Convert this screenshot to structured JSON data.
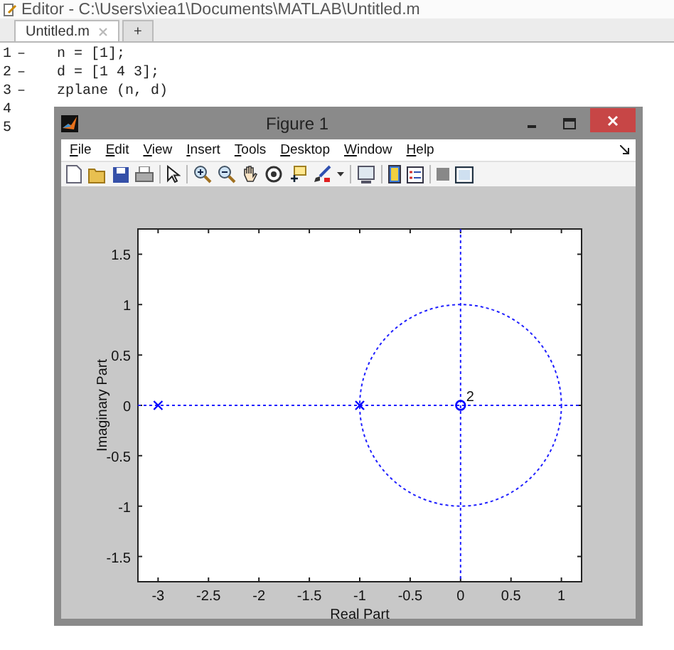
{
  "editor": {
    "title": "Editor - C:\\Users\\xiea1\\Documents\\MATLAB\\Untitled.m",
    "tabs": [
      {
        "label": "Untitled.m",
        "selected": true,
        "closable": true
      },
      {
        "label": "+",
        "selected": false,
        "closable": false
      }
    ],
    "lines": [
      {
        "number": "1",
        "marker": "–",
        "code": "n = [1];"
      },
      {
        "number": "2",
        "marker": "–",
        "code": "d = [1 4 3];"
      },
      {
        "number": "3",
        "marker": "–",
        "code": "zplane (n, d)"
      },
      {
        "number": "4"
      },
      {
        "number": "5"
      }
    ]
  },
  "figure": {
    "title": "Figure 1",
    "menu": [
      "File",
      "Edit",
      "View",
      "Insert",
      "Tools",
      "Desktop",
      "Window",
      "Help"
    ],
    "chart_data": {
      "type": "scatter",
      "xlabel": "Real Part",
      "ylabel": "Imaginary Part",
      "x": [
        -3,
        -1,
        0
      ],
      "series": [
        {
          "marker": "x",
          "color": "#0000ff",
          "values": [
            0,
            0,
            null
          ]
        },
        {
          "marker": "o",
          "color": "#0000ff",
          "values": [
            null,
            null,
            0
          ]
        }
      ],
      "xlim": [
        -3.2,
        1.2
      ],
      "ylim": [
        -1.75,
        1.75
      ],
      "xticks": [
        -3,
        -2.5,
        -2,
        -1.5,
        -1,
        -0.5,
        0,
        0.5,
        1
      ],
      "yticks": [
        -1.5,
        -1,
        -0.5,
        0,
        0.5,
        1,
        1.5
      ],
      "annotations": [
        {
          "x": 0,
          "y": 0,
          "text": "2"
        }
      ]
    }
  }
}
